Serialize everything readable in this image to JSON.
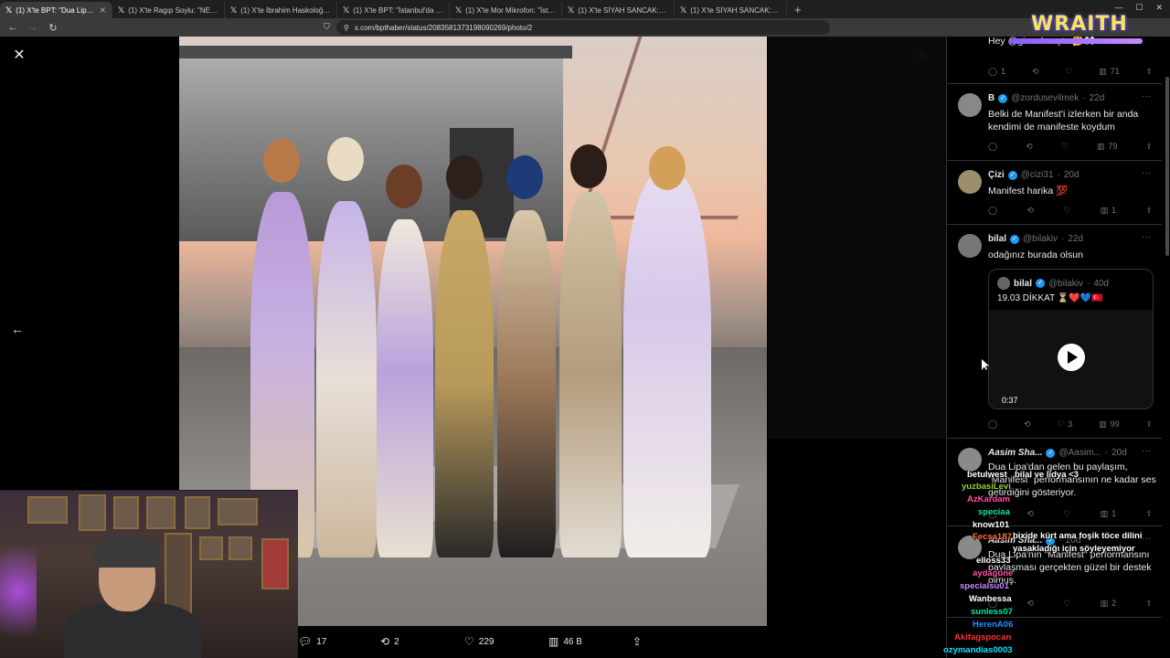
{
  "browser": {
    "tabs": [
      {
        "label": "(1) X'te BPT: \"Dua Lipa, Manifest\"",
        "active": true
      },
      {
        "label": "(1) X'te Ragıp Soylu: \"NEW: Turkey u",
        "active": false
      },
      {
        "label": "(1) X'te İbrahim Haskoloğlu: \"İstanb",
        "active": false
      },
      {
        "label": "(1) X'te BPT: \"İstanbul'da 38 yaşındal",
        "active": false
      },
      {
        "label": "(1) X'te Mor Mikrofon: \"İstanbul Gün",
        "active": false
      },
      {
        "label": "(1) X'te SİYAH SANCAK: \"🇹🇷 Kahram",
        "active": false
      },
      {
        "label": "(1) X'te SİYAH SANCAK: \"🇹🇷 Adana'",
        "active": false
      }
    ],
    "url": "x.com/bpthaber/status/2083581373198090269/photo/2"
  },
  "viewer": {
    "actions": {
      "replies": "17",
      "reposts": "2",
      "likes": "229",
      "views": "46 B"
    }
  },
  "replies": [
    {
      "name": "",
      "handle": "",
      "time": "",
      "text": "Hey @gi... olmuştu 🤔👀",
      "actions": {
        "replies": "1",
        "reposts": "",
        "likes": "",
        "views": "71"
      },
      "avatar_color": "#444"
    },
    {
      "name": "B",
      "handle": "@zordusevilmek",
      "time": "22d",
      "text": "Belki de Manifest'i izlerken bir anda kendimi de manifeste koydum",
      "actions": {
        "replies": "",
        "reposts": "",
        "likes": "",
        "views": "79"
      },
      "avatar_color": "#888"
    },
    {
      "name": "Çizi",
      "handle": "@cizi31",
      "time": "20d",
      "text": "Manifest harika 💯",
      "actions": {
        "replies": "",
        "reposts": "",
        "likes": "",
        "views": "1"
      },
      "avatar_color": "#9a8f6a"
    },
    {
      "name": "bilal",
      "handle": "@bilakiv",
      "time": "22d",
      "text": "odağınız burada olsun",
      "actions": {
        "replies": "",
        "reposts": "",
        "likes": "3",
        "views": "99"
      },
      "avatar_color": "#777",
      "quote": {
        "name": "bilal",
        "handle": "@bilakiv",
        "time": "40d",
        "text": "19.03 DİKKAT ⏳❤️💙🇹🇷",
        "video_time": "0:37"
      }
    },
    {
      "name": "Aasim Sha...",
      "handle": "@Aasim...",
      "time": "20d",
      "text": "Dua Lipa'dan gelen bu paylaşım, \"Manifest\" performansının ne kadar ses getirdiğini gösteriyor.",
      "actions": {
        "replies": "",
        "reposts": "",
        "likes": "",
        "views": "1"
      },
      "avatar_color": "#8a8a8a"
    },
    {
      "name": "Aasim Sha...",
      "handle": "",
      "time": "20d",
      "text": "Dua Lipa'nın \"Manifest\" performansını paylaşması gerçekten güzel bir destek olmuş.",
      "actions": {
        "replies": "",
        "reposts": "",
        "likes": "",
        "views": "2"
      },
      "avatar_color": "#8a8a8a"
    }
  ],
  "overlay": {
    "logo_text": "WRAITH",
    "chat": [
      {
        "name": "betulwest",
        "msg": "bilal ve lidya <3",
        "color": "#ffffff"
      },
      {
        "name": "yuzbasiLevi",
        "msg": "",
        "color": "#9acd32"
      },
      {
        "name": "AzKardam",
        "msg": "",
        "color": "#ff4fa3"
      },
      {
        "name": "speciaa",
        "msg": "",
        "color": "#00e5a0"
      },
      {
        "name": "know101",
        "msg": "",
        "color": "#ffffff"
      },
      {
        "name": "Fecsa187",
        "msg": "bixide kürt ama fosik töce dilini yasakladığı için söyleyemiyor",
        "color": "#ff6a3d"
      },
      {
        "name": "elloss33",
        "msg": "",
        "color": "#ffffff"
      },
      {
        "name": "aydagune",
        "msg": "",
        "color": "#ff4fa3"
      },
      {
        "name": "specialsu01",
        "msg": "",
        "color": "#c58aff"
      },
      {
        "name": "Wanbessa",
        "msg": "",
        "color": "#ffffff"
      },
      {
        "name": "sunless07",
        "msg": "",
        "color": "#00e5a0"
      },
      {
        "name": "HerenA06",
        "msg": "",
        "color": "#1e90ff"
      },
      {
        "name": "Akifagspocan",
        "msg": "",
        "color": "#ff3030"
      },
      {
        "name": "ozymandias0003",
        "msg": "",
        "color": "#00e5ff"
      }
    ]
  }
}
